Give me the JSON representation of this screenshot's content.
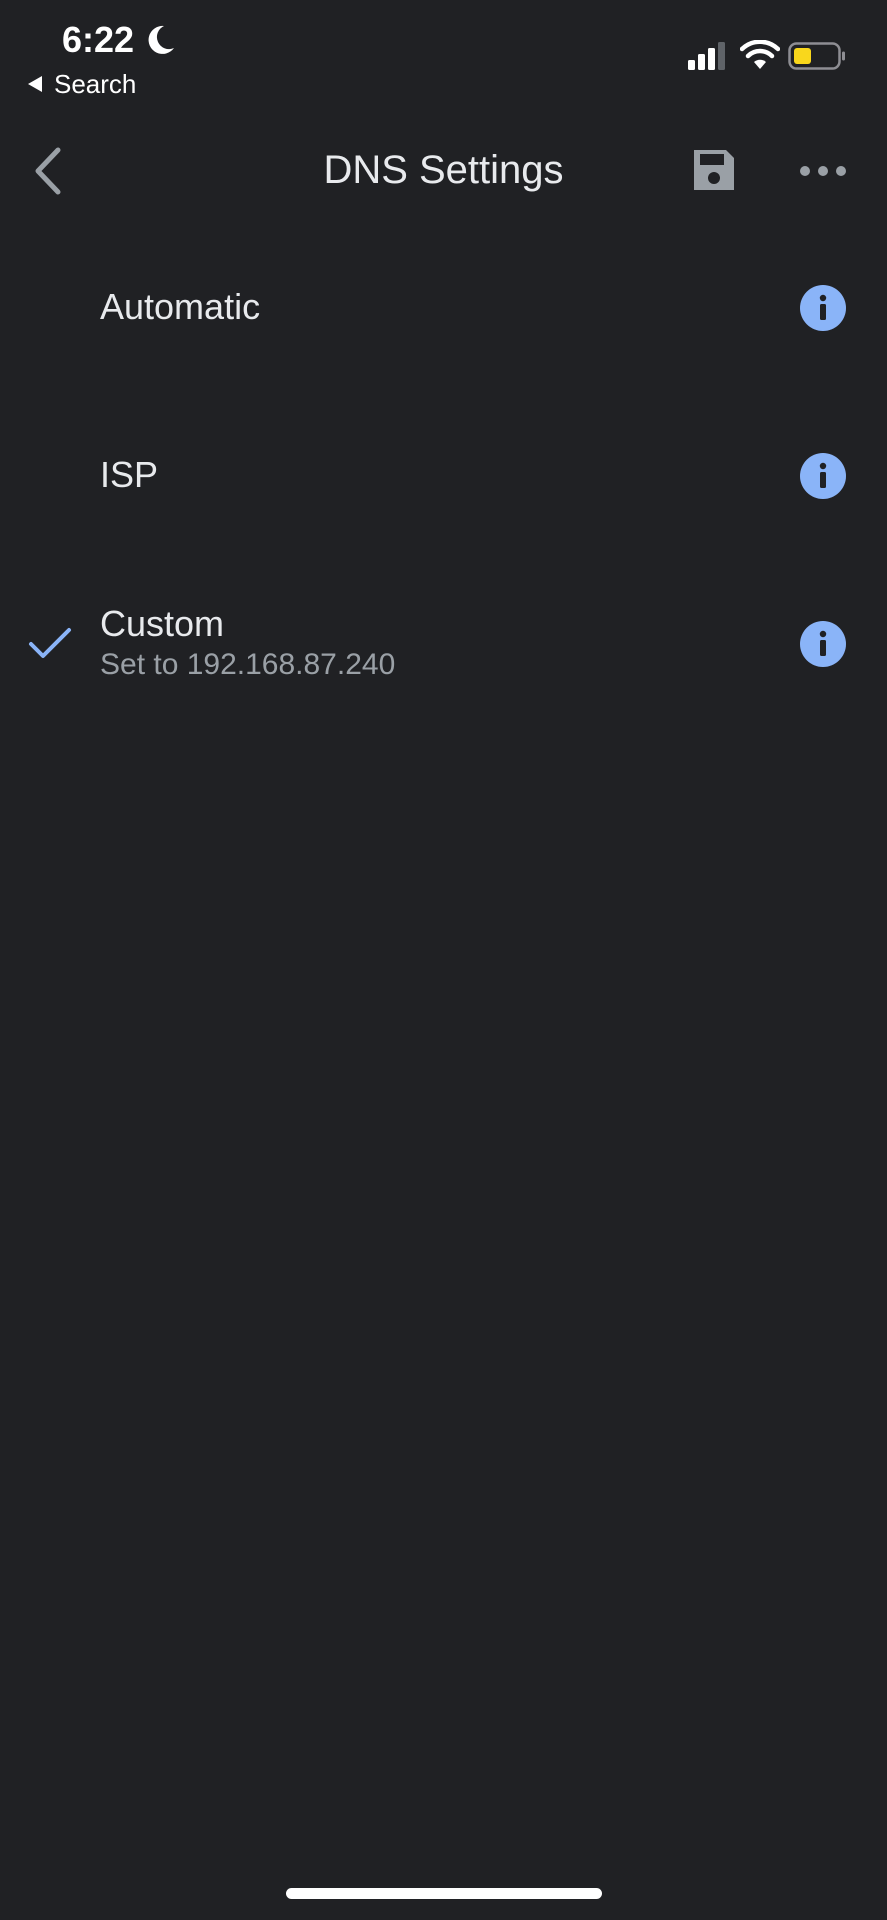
{
  "status_bar": {
    "time": "6:22",
    "back_app": "Search"
  },
  "header": {
    "title": "DNS Settings",
    "back_icon": "chevron-left-icon",
    "save_icon": "save-icon",
    "more_icon": "more-horiz-icon"
  },
  "dns_options": [
    {
      "label": "Automatic",
      "subtitle": "",
      "selected": false
    },
    {
      "label": "ISP",
      "subtitle": "",
      "selected": false
    },
    {
      "label": "Custom",
      "subtitle": "Set to 192.168.87.240",
      "selected": true
    }
  ],
  "colors": {
    "background": "#202124",
    "accent": "#8ab4f8",
    "text_primary": "#e8eaed",
    "text_secondary": "#9aa0a6",
    "battery_fill": "#f9d71c"
  }
}
